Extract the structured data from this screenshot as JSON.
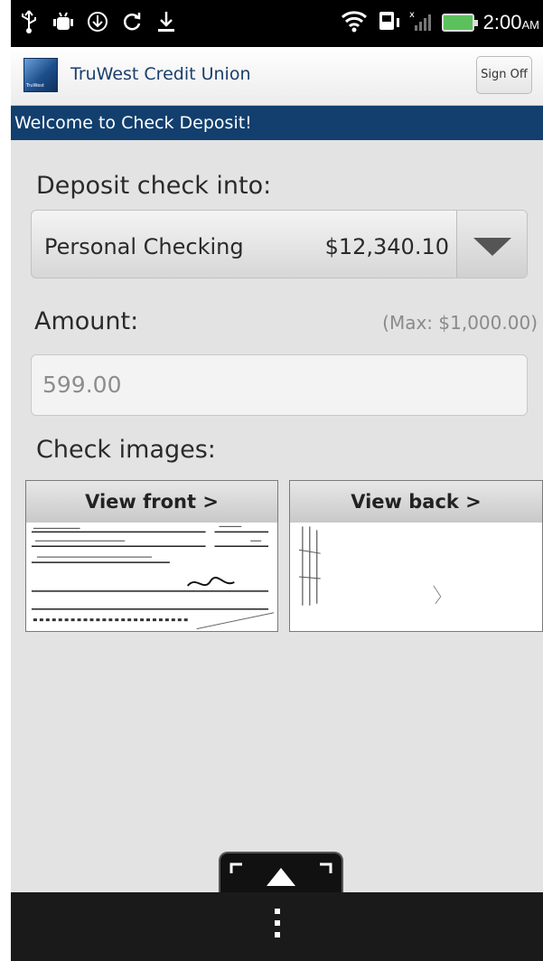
{
  "status_bar": {
    "left_icons": [
      "usb-icon",
      "android-debug-icon",
      "download-status-icon",
      "sync-icon",
      "download-icon"
    ],
    "right_icons": [
      "wifi-icon",
      "sim-icon",
      "signal-icon",
      "battery-icon"
    ],
    "time": "2:00",
    "ampm": "AM"
  },
  "header": {
    "logo_text": "TruWest",
    "title": "TruWest Credit Union",
    "signoff_label": "Sign Off"
  },
  "welcome": "Welcome to Check Deposit!",
  "deposit": {
    "label": "Deposit check into:",
    "account_name": "Personal Checking",
    "account_balance": "$12,340.10"
  },
  "amount": {
    "label": "Amount:",
    "max": "(Max: $1,000.00)",
    "value": "599.00"
  },
  "images": {
    "label": "Check images:",
    "front_label": "View front >",
    "back_label": "View back >"
  },
  "colors": {
    "brand_navy": "#123f6e",
    "background": "#e3e3e3",
    "status_bar": "#000000"
  }
}
